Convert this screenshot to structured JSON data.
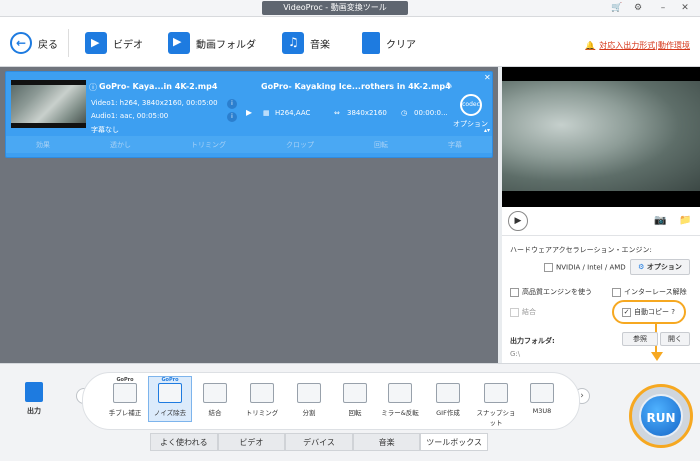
{
  "window": {
    "title": "VideoProc - 動画変換ツール",
    "controls": [
      "cart-icon",
      "gear-icon",
      "minimize-icon",
      "close-icon"
    ]
  },
  "toolbar": {
    "back_label": "戻る",
    "video_label": "ビデオ",
    "folder_label": "動画フォルダ",
    "music_label": "音楽",
    "clear_label": "クリア",
    "link_label": "対応入出力形式|動作環境"
  },
  "clip": {
    "source_name": "GoPro- Kaya...in 4K-2.mp4",
    "video_info": "Video1: h264, 3840x2160, 00:05:00",
    "audio_info": "Audio1: aac, 00:05:00",
    "subtitle": "字幕なし",
    "output_name": "GoPro- Kayaking Ice...rothers in 4K-2.mp4",
    "codec": "H264,AAC",
    "resolution": "3840x2160",
    "duration": "00:00:0...",
    "option_label": "オプション",
    "codec_badge": "codec"
  },
  "edit_tools": [
    "効果",
    "透かし",
    "トリミング",
    "クロップ",
    "回転",
    "字幕"
  ],
  "hw": {
    "title": "ハードウェアアクセラレーション・エンジン:",
    "engine": "NVIDIA / Intel / AMD",
    "option_btn": "オプション",
    "hq_engine": "高品質エンジンを使う",
    "deinterlace": "インターレース解除",
    "merge": "結合",
    "autocopy": "自動コピー",
    "autocopy_help": "?",
    "out_folder_label": "出力フォルダ:",
    "browse": "参照",
    "open": "開く",
    "path": "G:\\"
  },
  "output_label": "出力",
  "tools": [
    {
      "label": "手ブレ補正",
      "badge": "GoPro"
    },
    {
      "label": "ノイズ除去",
      "badge": "GoPro"
    },
    {
      "label": "結合",
      "badge": ""
    },
    {
      "label": "トリミング",
      "badge": ""
    },
    {
      "label": "分割",
      "badge": ""
    },
    {
      "label": "回転",
      "badge": ""
    },
    {
      "label": "ミラー&反転",
      "badge": ""
    },
    {
      "label": "GIF作成",
      "badge": ""
    },
    {
      "label": "スナップショット",
      "badge": ""
    },
    {
      "label": "M3U8",
      "badge": ""
    }
  ],
  "tabs": [
    "よく使われる",
    "ビデオ",
    "デバイス",
    "音楽",
    "ツールボックス"
  ],
  "run_label": "RUN",
  "colors": {
    "accent": "#1e7be0",
    "clip_bg": "#3d9ff1",
    "highlight": "#f6a821",
    "link": "#d6381b"
  }
}
